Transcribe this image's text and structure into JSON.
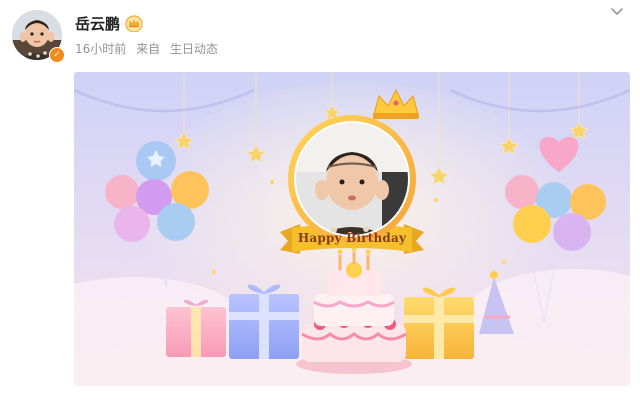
{
  "post": {
    "user_name": "岳云鹏",
    "time_ago": "16小时前",
    "source_prefix": "来自",
    "source_name": "生日动态"
  },
  "icons": {
    "verified_badge": "verified-v-icon",
    "crown_badge": "crown-badge-icon",
    "more": "chevron-down-icon"
  },
  "banner": {
    "birthday_text": "Happy Birthday"
  },
  "colors": {
    "name": "#222222",
    "meta": "#939393",
    "verified": "#f08a1c",
    "ribbon": "#f5c02c",
    "ribbon_text": "#8a3a10"
  }
}
